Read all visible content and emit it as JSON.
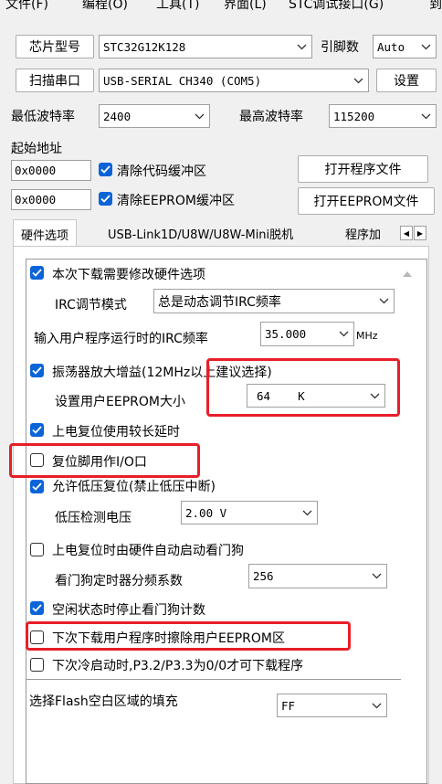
{
  "menu": [
    "文件(F)",
    "编程(O)",
    "工具(T)",
    "界面(L)",
    "STC调试接口(G)",
    "到"
  ],
  "chip": {
    "button": "芯片型号",
    "value": "STC32G12K128",
    "pins_label": "引脚数",
    "pins_value": "Auto"
  },
  "port": {
    "button": "扫描串口",
    "value": "USB-SERIAL CH340 (COM5)",
    "settings": "设置"
  },
  "baud": {
    "min_label": "最低波特率",
    "min_value": "2400",
    "max_label": "最高波特率",
    "max_value": "115200"
  },
  "address": {
    "title": "起始地址",
    "code_addr": "0x0000",
    "code_clear": "清除代码缓冲区",
    "open_program": "打开程序文件",
    "eeprom_addr": "0x0000",
    "eeprom_clear": "清除EEPROM缓冲区",
    "open_eeprom": "打开EEPROM文件"
  },
  "tabs": [
    "硬件选项",
    "USB-Link1D/U8W/U8W-Mini脱机",
    "程序加"
  ],
  "options": {
    "modify_hw": "本次下载需要修改硬件选项",
    "irc_mode_label": "IRC调节模式",
    "irc_mode_value": "总是动态调节IRC频率",
    "irc_freq_label": "输入用户程序运行时的IRC频率",
    "irc_freq_value": "35.000",
    "irc_freq_unit": "MHz",
    "osc_gain": "振荡器放大增益(12MHz以上建议选择)",
    "eeprom_size_label": "设置用户EEPROM大小",
    "eeprom_size_value": "64    K",
    "power_reset_delay": "上电复位使用较长延时",
    "reset_as_io": "复位脚用作I/O口",
    "low_voltage_reset": "允许低压复位(禁止低压中断)",
    "lv_detect_label": "低压检测电压",
    "lv_detect_value": "2.00 V",
    "wdt_auto": "上电复位时由硬件自动启动看门狗",
    "wdt_div_label": "看门狗定时器分频系数",
    "wdt_div_value": "256",
    "idle_stop_wdt": "空闲状态时停止看门狗计数",
    "erase_eeprom": "下次下载用户程序时擦除用户EEPROM区",
    "cold_boot": "下次冷启动时,P3.2/P3.3为0/0才可下载程序",
    "flash_fill_label": "选择Flash空白区域的填充",
    "flash_fill_value": "FF"
  },
  "colors": {
    "accent": "#0a64d8",
    "highlight": "#e81e28"
  }
}
